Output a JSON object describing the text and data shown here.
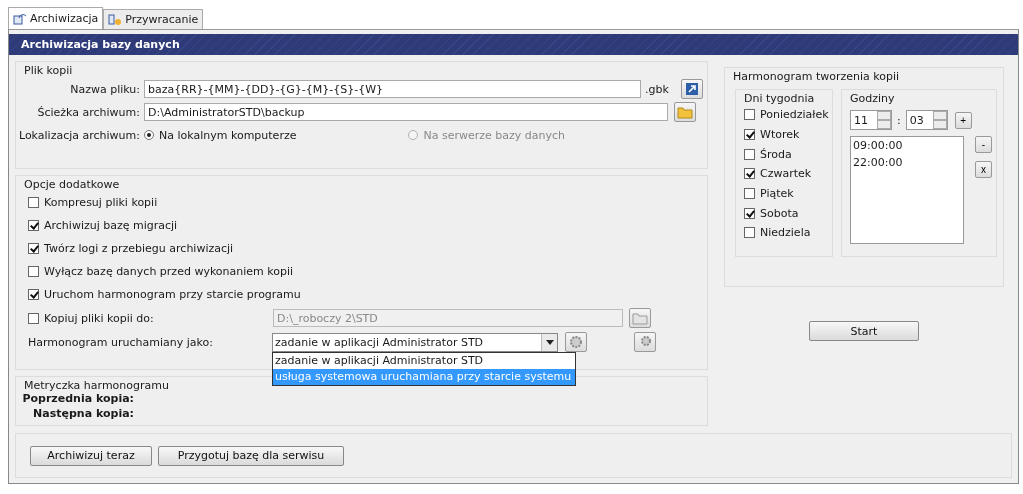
{
  "tabs": [
    {
      "label": "Archiwizacja",
      "selected": true
    },
    {
      "label": "Przywracanie",
      "selected": false
    }
  ],
  "header": {
    "title": "Archiwizacja bazy danych"
  },
  "file_group": {
    "title": "Plik kopii",
    "name_field": {
      "label": "Nazwa pliku:",
      "value": "baza{RR}-{MM}-{DD}-{G}-{M}-{S}-{W}",
      "suffix": ".gbk"
    },
    "path_field": {
      "label": "Ścieżka archiwum:",
      "value": "D:\\AdministratorSTD\\backup"
    },
    "location": {
      "label": "Lokalizacja archiwum:",
      "options": [
        {
          "label": "Na lokalnym komputerze",
          "selected": true,
          "disabled": false
        },
        {
          "label": "Na serwerze bazy danych",
          "selected": false,
          "disabled": true
        }
      ]
    }
  },
  "options_group": {
    "title": "Opcje dodatkowe",
    "checkboxes": [
      {
        "label": "Kompresuj pliki kopii",
        "checked": false
      },
      {
        "label": "Archiwizuj bazę migracji",
        "checked": true
      },
      {
        "label": "Twórz logi z przebiegu archiwizacji",
        "checked": true
      },
      {
        "label": "Wyłącz bazę danych przed wykonaniem kopii",
        "checked": false
      },
      {
        "label": "Uruchom harmonogram przy starcie programu",
        "checked": true
      }
    ],
    "copy_to": {
      "label": "Kopiuj pliki kopii do:",
      "checked": false,
      "value": "D:\\_roboczy 2\\STD",
      "disabled": true
    },
    "run_as": {
      "label": "Harmonogram uruchamiany jako:",
      "value": "zadanie w aplikacji Administrator STD",
      "options": [
        {
          "label": "zadanie w aplikacji Administrator STD",
          "highlighted": false
        },
        {
          "label": "usługa systemowa uruchamiana przy starcie systemu",
          "highlighted": true
        }
      ]
    }
  },
  "metrics": {
    "title": "Metryczka harmonogramu",
    "rows": [
      {
        "label": "Poprzednia kopia:"
      },
      {
        "label": "Następna kopia:"
      }
    ]
  },
  "buttons": [
    "Archiwizuj teraz",
    "Przygotuj bazę dla serwisu"
  ],
  "schedule": {
    "title": "Harmonogram tworzenia kopii",
    "days": {
      "title": "Dni tygodnia",
      "items": [
        {
          "label": "Poniedziałek",
          "checked": false
        },
        {
          "label": "Wtorek",
          "checked": true
        },
        {
          "label": "Środa",
          "checked": false
        },
        {
          "label": "Czwartek",
          "checked": true
        },
        {
          "label": "Piątek",
          "checked": false
        },
        {
          "label": "Sobota",
          "checked": true
        },
        {
          "label": "Niedziela",
          "checked": false
        }
      ]
    },
    "hours": {
      "title": "Godziny",
      "hour": "11",
      "separator": ":",
      "minute": "03",
      "add": "+",
      "remove": "-",
      "clear": "x",
      "times": [
        "09:00:00",
        "22:00:00"
      ]
    },
    "start": "Start"
  }
}
